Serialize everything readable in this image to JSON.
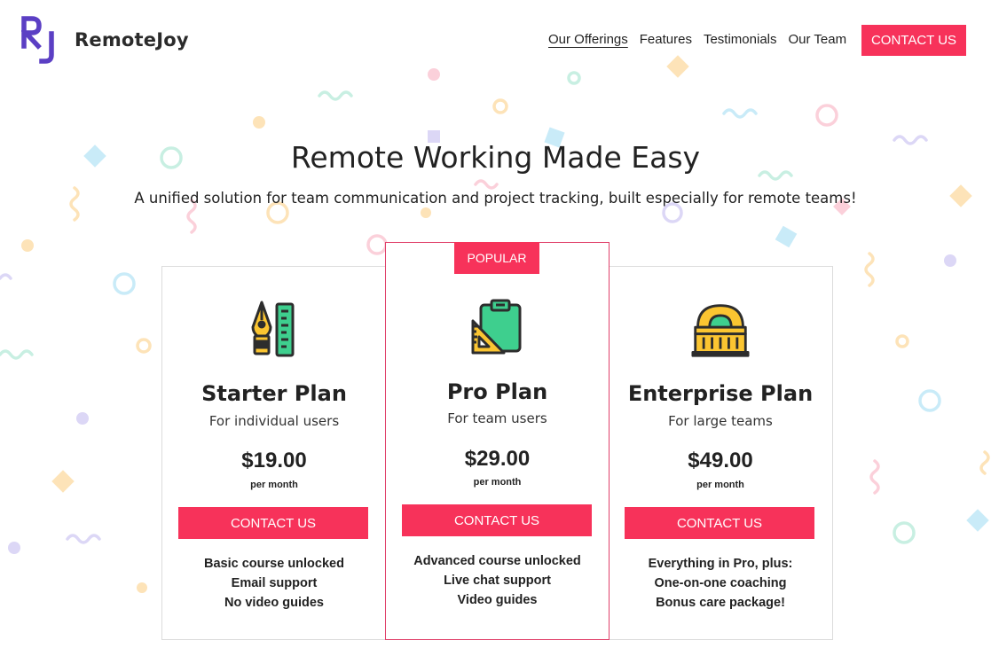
{
  "brand": {
    "name": "RemoteJoy",
    "logo_mark": "RJ",
    "logo_color": "#5b3fc4"
  },
  "nav": {
    "items": [
      {
        "label": "Our Offerings",
        "active": true
      },
      {
        "label": "Features",
        "active": false
      },
      {
        "label": "Testimonials",
        "active": false
      },
      {
        "label": "Our Team",
        "active": false
      }
    ],
    "cta_label": "CONTACT US"
  },
  "hero": {
    "title": "Remote Working Made Easy",
    "subtitle": "A unified solution for team communication and project tracking, built especially for remote teams!"
  },
  "plans": [
    {
      "name": "Starter Plan",
      "audience": "For individual users",
      "price": "$19.00",
      "period": "per month",
      "cta": "CONTACT US",
      "icon": "pen-ruler-icon",
      "features": [
        "Basic course unlocked",
        "Email support",
        "No video guides"
      ]
    },
    {
      "name": "Pro Plan",
      "audience": "For team users",
      "price": "$29.00",
      "period": "per month",
      "cta": "CONTACT US",
      "icon": "clipboard-set-square-icon",
      "badge": "POPULAR",
      "features": [
        "Advanced course unlocked",
        "Live chat support",
        "Video guides"
      ]
    },
    {
      "name": "Enterprise Plan",
      "audience": "For large teams",
      "price": "$49.00",
      "period": "per month",
      "cta": "CONTACT US",
      "icon": "building-icon",
      "features": [
        "Everything in Pro, plus:",
        "One-on-one coaching",
        "Bonus care package!"
      ]
    }
  ],
  "colors": {
    "accent": "#f7325a",
    "pro_border": "#e0406a",
    "logo": "#5b3fc4",
    "icon_green": "#3ecf8e",
    "icon_yellow": "#fbc531",
    "icon_outline": "#2d2d2d"
  }
}
